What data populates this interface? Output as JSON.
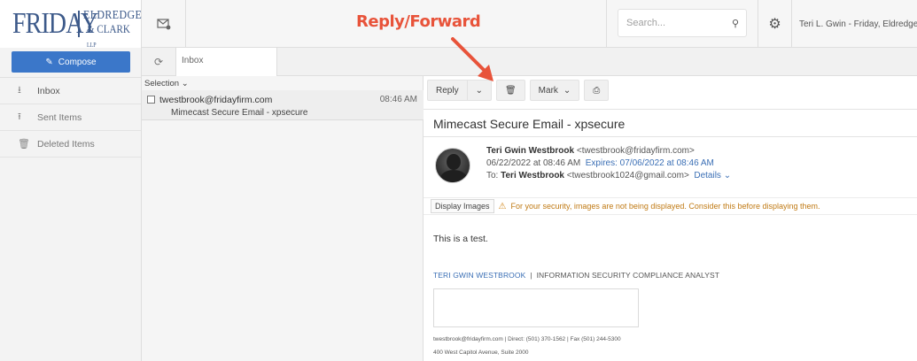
{
  "header": {
    "logo_main": "FRIDAY",
    "logo_sub1": "ELDREDGE",
    "logo_sub2": "& CLARK",
    "logo_llp": "LLP",
    "annotation": "Reply/Forward",
    "search_placeholder": "Search...",
    "user": "Teri L. Gwin - Friday, Eldredge & Clark"
  },
  "sidebar": {
    "compose_label": "Compose",
    "items": [
      {
        "label": "Inbox",
        "icon": "inbox-icon"
      },
      {
        "label": "Sent Items",
        "icon": "sent-icon"
      },
      {
        "label": "Deleted Items",
        "icon": "trash-icon"
      }
    ]
  },
  "folder": {
    "tab_label": "Inbox",
    "selection_label": "Selection"
  },
  "messages": [
    {
      "from": "twestbrook@fridayfirm.com",
      "time": "08:46 AM",
      "subject": "Mimecast Secure Email - xpsecure"
    }
  ],
  "toolbar": {
    "reply_label": "Reply",
    "mark_label": "Mark"
  },
  "email": {
    "subject": "Mimecast Secure Email - xpsecure",
    "sender_name": "Teri Gwin Westbrook",
    "sender_email": "<twestbrook@fridayfirm.com>",
    "date": "06/22/2022 at 08:46 AM",
    "expires": "Expires: 07/06/2022 at 08:46 AM",
    "to_prefix": "To:",
    "to_name": "Teri Westbrook",
    "to_email": "<twestbrook1024@gmail.com>",
    "details_label": "Details",
    "display_images_label": "Display Images",
    "security_warning": "For your security, images are not being displayed. Consider this before displaying them.",
    "body": "This is a test.",
    "sig_name": "TERI GWIN WESTBROOK",
    "sig_separator": "|",
    "sig_title": "INFORMATION SECURITY COMPLIANCE ANALYST",
    "sig_contact": "twestbrook@fridayfirm.com  |  Direct: (501) 370-1562  |  Fax (501) 244-5300",
    "sig_address": "400 West Capitol Avenue, Suite 2000"
  },
  "colors": {
    "accent": "#3b77c9",
    "brand": "#3d5a8a",
    "annotation": "#e8533a",
    "warning": "#c07a14"
  }
}
